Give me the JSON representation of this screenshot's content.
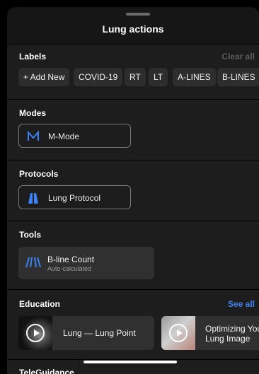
{
  "sheet": {
    "title": "Lung actions"
  },
  "labels": {
    "title": "Labels",
    "clear_all": "Clear all",
    "chips": [
      "+ Add New",
      "COVID-19",
      "RT",
      "LT",
      "A-LINES",
      "B-LINES"
    ]
  },
  "modes": {
    "title": "Modes",
    "item": "M-Mode",
    "icon": "m-mode-icon"
  },
  "protocols": {
    "title": "Protocols",
    "item": "Lung Protocol",
    "icon": "lung-icon"
  },
  "tools": {
    "title": "Tools",
    "item_title": "B-line Count",
    "item_subtitle": "Auto-calculated",
    "icon": "b-line-icon"
  },
  "education": {
    "title": "Education",
    "see_all": "See all",
    "items": [
      {
        "label": "Lung — Lung Point"
      },
      {
        "label_line1": "Optimizing You",
        "label_line2": "Lung Image"
      }
    ]
  },
  "teleguidance": {
    "title": "TeleGuidance"
  },
  "colors": {
    "accent": "#3b82f6",
    "muted": "#5a5a5a",
    "card": "#303030"
  }
}
